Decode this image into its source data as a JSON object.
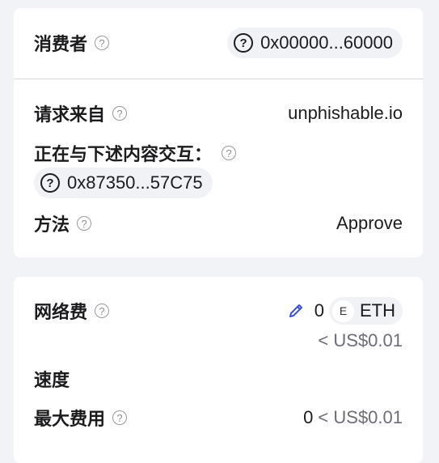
{
  "request": {
    "consumer": {
      "label": "消费者",
      "address": "0x00000...60000"
    },
    "request_from": {
      "label": "请求来自",
      "value": "unphishable.io"
    },
    "interacting": {
      "label": "正在与下述内容交互：",
      "address": "0x87350...57C75"
    },
    "method": {
      "label": "方法",
      "value": "Approve"
    }
  },
  "fees": {
    "network_fee": {
      "label": "网络费",
      "amount": "0",
      "token_badge": "E",
      "token": "ETH",
      "fiat": "< US$0.01"
    },
    "speed": {
      "label": "速度"
    },
    "max_fee": {
      "label": "最大费用",
      "amount": "0",
      "fiat": "< US$0.01"
    }
  },
  "help_glyph": "?",
  "colors": {
    "background": "#f2f3f7",
    "card": "#ffffff",
    "pill": "#f1f2f6",
    "edit_accent": "#3b4fd8",
    "muted_text": "#6d6d75"
  },
  "icons": {
    "help": "question-circle-icon",
    "unknown_avatar": "question-circle-icon",
    "edit": "pencil-icon"
  }
}
